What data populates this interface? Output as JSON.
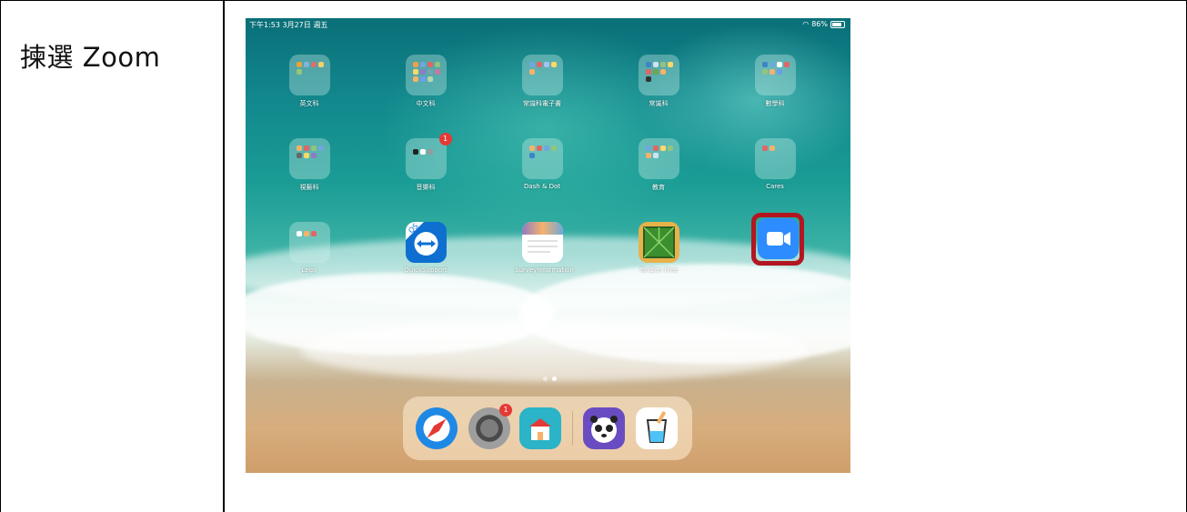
{
  "instruction": "揀選 Zoom",
  "status": {
    "left": "下午1:53  3月27日 週五",
    "battery": "86%"
  },
  "apps": {
    "row1": [
      "英文科",
      "中文科",
      "常識科電子書",
      "常識科",
      "數學科"
    ],
    "row2": [
      "視藝科",
      "音樂科",
      "Dash & Dot",
      "教育",
      "Cares"
    ],
    "row3": [
      "Lego",
      "QuickSupport",
      "SurveyInformation",
      "TanZen Free",
      ""
    ]
  },
  "badges": {
    "music": "1",
    "settings": "1"
  },
  "colors": {
    "highlight": "#b31621",
    "zoom": "#2d8cff"
  }
}
